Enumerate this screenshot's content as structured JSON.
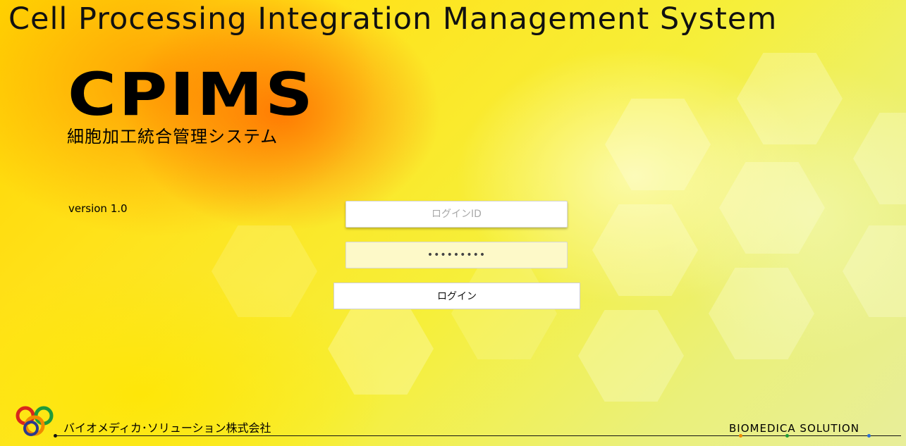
{
  "header": {
    "title": "Cell Processing Integration Management System"
  },
  "brand": {
    "logo_text": "CPIMS",
    "subtitle": "細胞加工統合管理システム",
    "version": "version 1.0"
  },
  "login_form": {
    "login_id_placeholder": "ログインID",
    "login_id_value": "",
    "password_value": "•••••••••",
    "login_button_label": "ログイン"
  },
  "footer": {
    "company_name": "バイオメディカ･ソリューション株式会社",
    "brand_name": "BIOMEDICA SOLUTION"
  },
  "colors": {
    "accent_orange": "#ff8a00",
    "accent_yellow": "#ffe21a",
    "password_bg": "#fdf9c8"
  }
}
